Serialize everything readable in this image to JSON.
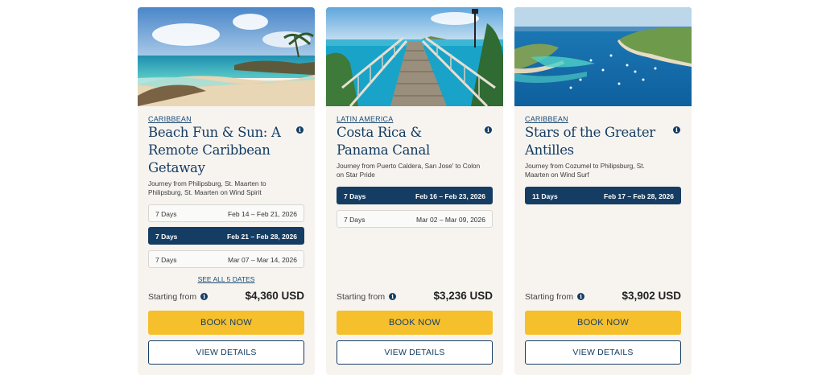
{
  "cards": [
    {
      "image_alt": "Caribbean beach with rocks and palm trees",
      "region": "CARIBBEAN",
      "title": "Beach Fun & Sun: A Remote Caribbean Getaway",
      "journey": "Journey from Philipsburg, St. Maarten to Philipsburg, St. Maarten on Wind Spirit",
      "dates": [
        {
          "days": "7 Days",
          "range": "Feb 14 – Feb 21, 2026",
          "selected": false
        },
        {
          "days": "7 Days",
          "range": "Feb 21 – Feb 28, 2026",
          "selected": true
        },
        {
          "days": "7 Days",
          "range": "Mar 07 – Mar 14, 2026",
          "selected": false
        }
      ],
      "see_all": "SEE ALL 5 DATES",
      "starting_label": "Starting from",
      "price": "$4,360 USD",
      "book_label": "BOOK NOW",
      "details_label": "VIEW DETAILS"
    },
    {
      "image_alt": "Wooden pier over turquoise water",
      "region": "LATIN AMERICA",
      "title": "Costa Rica & Panama Canal",
      "journey": "Journey from Puerto Caldera, San Jose' to Colon on Star Pride",
      "dates": [
        {
          "days": "7 Days",
          "range": "Feb 16 – Feb 23, 2026",
          "selected": true
        },
        {
          "days": "7 Days",
          "range": "Mar 02 – Mar 09, 2026",
          "selected": false
        }
      ],
      "starting_label": "Starting from",
      "price": "$3,236 USD",
      "book_label": "BOOK NOW",
      "details_label": "VIEW DETAILS"
    },
    {
      "image_alt": "Aerial view of a bay with sailboats",
      "region": "CARIBBEAN",
      "title": "Stars of the Greater Antilles",
      "journey": "Journey from Cozumel to Philipsburg, St. Maarten on Wind Surf",
      "dates": [
        {
          "days": "11 Days",
          "range": "Feb 17 – Feb 28, 2026",
          "selected": true
        }
      ],
      "starting_label": "Starting from",
      "price": "$3,902 USD",
      "book_label": "BOOK NOW",
      "details_label": "VIEW DETAILS"
    }
  ],
  "icons": {
    "info": "info-icon"
  },
  "colors": {
    "navy": "#153d63",
    "yellow": "#f6c02c",
    "card_bg": "#f7f4f0"
  }
}
